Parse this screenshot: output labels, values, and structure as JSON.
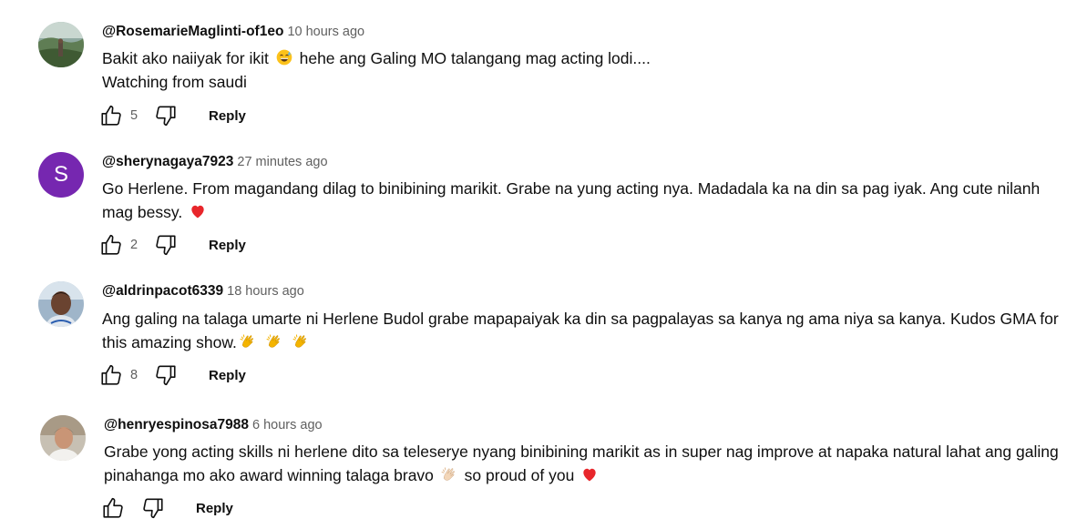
{
  "comments": [
    {
      "author": "@RosemarieMaglinti-of1eo",
      "time": "10 hours ago",
      "line1a": "Bakit ako naiiyak for ikit",
      "line1b": "hehe ang Galing MO talangang mag acting lodi....",
      "line2": "Watching from saudi",
      "likes": "5",
      "reply_label": "Reply",
      "avatar_icon": "photo-avatar-landscape"
    },
    {
      "author": "@sherynagaya7923",
      "time": "27 minutes ago",
      "avatar_letter": "S",
      "line1": "Go Herlene. From magandang dilag to binibining marikit. Grabe na yung acting nya. Madadala ka na din sa pag iyak. Ang cute nilanh",
      "line2": "mag bessy.",
      "likes": "2",
      "reply_label": "Reply",
      "avatar_color": "#7627b0"
    },
    {
      "author": "@aldrinpacot6339",
      "time": "18 hours ago",
      "line1": "Ang galing na talaga umarte ni Herlene Budol grabe mapapaiyak ka din sa pagpalayas sa kanya ng ama niya sa kanya. Kudos GMA for",
      "line2": "this amazing show.",
      "likes": "8",
      "reply_label": "Reply",
      "avatar_icon": "photo-avatar-person"
    },
    {
      "author": "@henryespinosa7988",
      "time": "6 hours ago",
      "line1": "Grabe yong acting skills ni herlene dito sa teleserye nyang binibining marikit as in super nag improve at napaka natural lahat ang galing",
      "line2a": "pinahanga mo ako award winning talaga bravo",
      "line2b": "so proud of you",
      "likes": "",
      "reply_label": "Reply",
      "avatar_icon": "photo-avatar-person"
    }
  ],
  "icons": {
    "like": "thumbs-up-icon",
    "dislike": "thumbs-down-icon",
    "emoji_smile": "grinning-sweat-emoji",
    "emoji_heart": "red-heart-emoji",
    "emoji_clap": "clapping-hands-emoji"
  },
  "colors": {
    "text": "#0f0f0f",
    "secondary": "#606060",
    "heart": "#e8262b",
    "clap": "#f4b400"
  }
}
